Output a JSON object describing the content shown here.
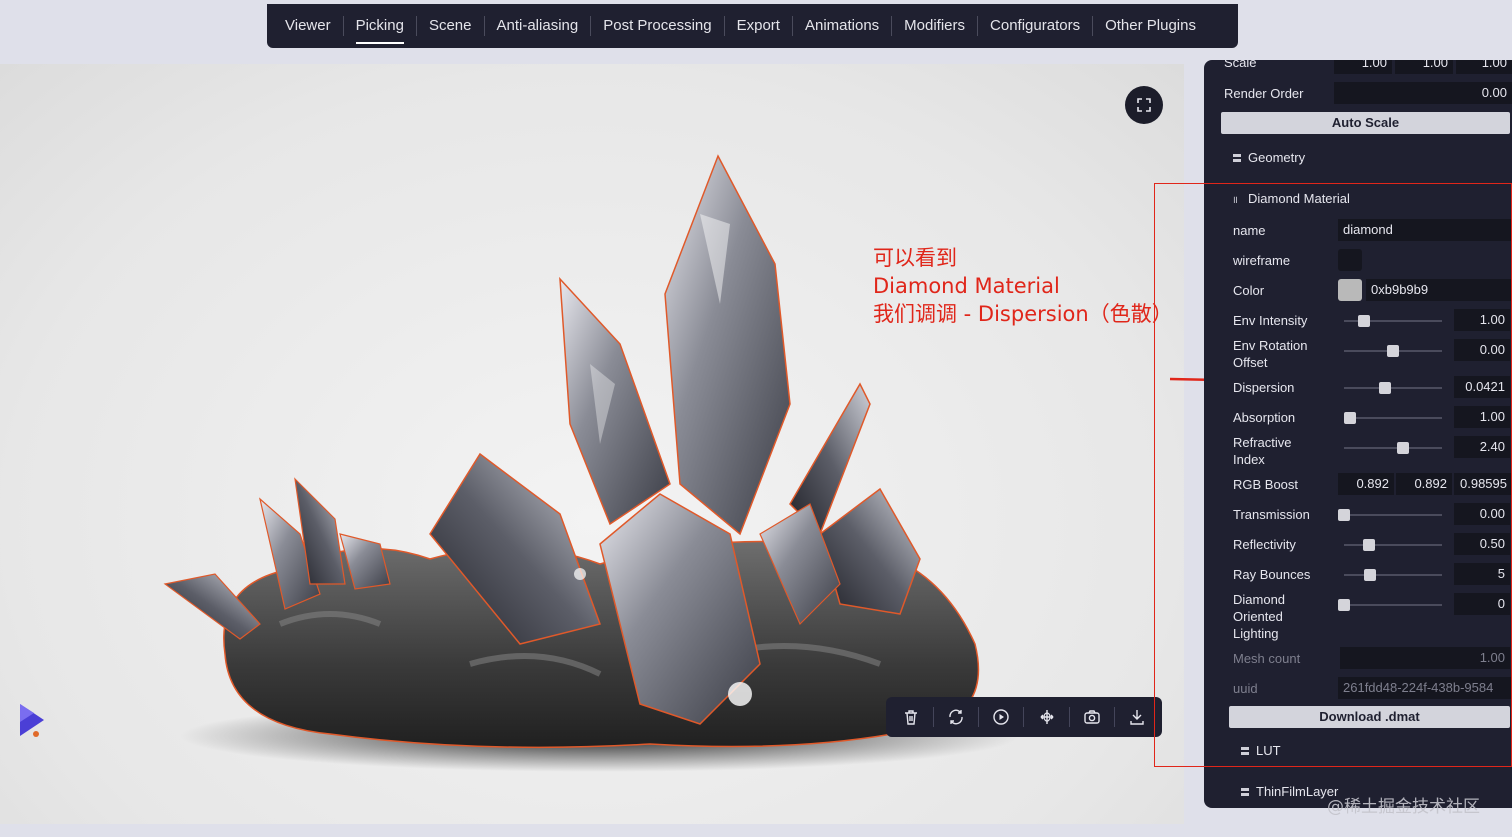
{
  "nav": {
    "tabs": [
      {
        "label": "Viewer"
      },
      {
        "label": "Picking"
      },
      {
        "label": "Scene"
      },
      {
        "label": "Anti-aliasing"
      },
      {
        "label": "Post Processing"
      },
      {
        "label": "Export"
      },
      {
        "label": "Animations"
      },
      {
        "label": "Modifiers"
      },
      {
        "label": "Configurators"
      },
      {
        "label": "Other Plugins"
      }
    ],
    "active_tab": "Picking"
  },
  "annotation": {
    "lines": [
      "可以看到",
      "Diamond Material",
      "我们调调 - Dispersion（色散）"
    ]
  },
  "toolbar": {
    "icons": [
      "trash-icon",
      "rotate-icon",
      "play-icon",
      "pivot-icon",
      "camera-icon",
      "download-icon"
    ]
  },
  "panel": {
    "scale_row": {
      "label": "Scale",
      "values": [
        "1.00",
        "1.00",
        "1.00"
      ]
    },
    "render_order": {
      "label": "Render Order",
      "value": "0.00"
    },
    "auto_scale_label": "Auto Scale",
    "geometry_folder": "Geometry",
    "diamond_folder": "Diamond Material",
    "name": {
      "label": "name",
      "value": "diamond"
    },
    "wireframe": {
      "label": "wireframe",
      "checked": false
    },
    "color": {
      "label": "Color",
      "value": "0xb9b9b9",
      "swatch": "#b9b9b9"
    },
    "env_intensity": {
      "label": "Env Intensity",
      "value": "1.00",
      "level": 0.2
    },
    "env_rotation": {
      "label_1": "Env Rotation",
      "label_2": "Offset",
      "value": "0.00",
      "level": 0.5
    },
    "dispersion": {
      "label": "Dispersion",
      "value": "0.0421",
      "level": 0.42
    },
    "absorption": {
      "label": "Absorption",
      "value": "1.00",
      "level": 0.06
    },
    "refractive": {
      "label_1": "Refractive",
      "label_2": "Index",
      "value": "2.40",
      "level": 0.6
    },
    "rgb_boost": {
      "label": "RGB Boost",
      "values": [
        "0.892",
        "0.892",
        "0.98595"
      ]
    },
    "transmission": {
      "label": "Transmission",
      "value": "0.00",
      "level": 0.0
    },
    "reflectivity": {
      "label": "Reflectivity",
      "value": "0.50",
      "level": 0.25
    },
    "ray_bounces": {
      "label": "Ray Bounces",
      "value": "5",
      "level": 0.27
    },
    "diamond_lighting": {
      "label_1": "Diamond",
      "label_2": "Oriented",
      "label_3": "Lighting",
      "value": "0",
      "level": 0.0
    },
    "mesh_count": {
      "label": "Mesh count",
      "value": "1.00"
    },
    "uuid": {
      "label": "uuid",
      "value": "261fdd48-224f-438b-9584"
    },
    "download_label": "Download .dmat",
    "lut_folder": "LUT",
    "thinfilm_folder": "ThinFilmLayer"
  },
  "watermark": "@稀土掘金技术社区",
  "colors": {
    "panel_bg": "#1f2030",
    "annotation": "#e0261a",
    "highlight_border": "#e0261a"
  }
}
